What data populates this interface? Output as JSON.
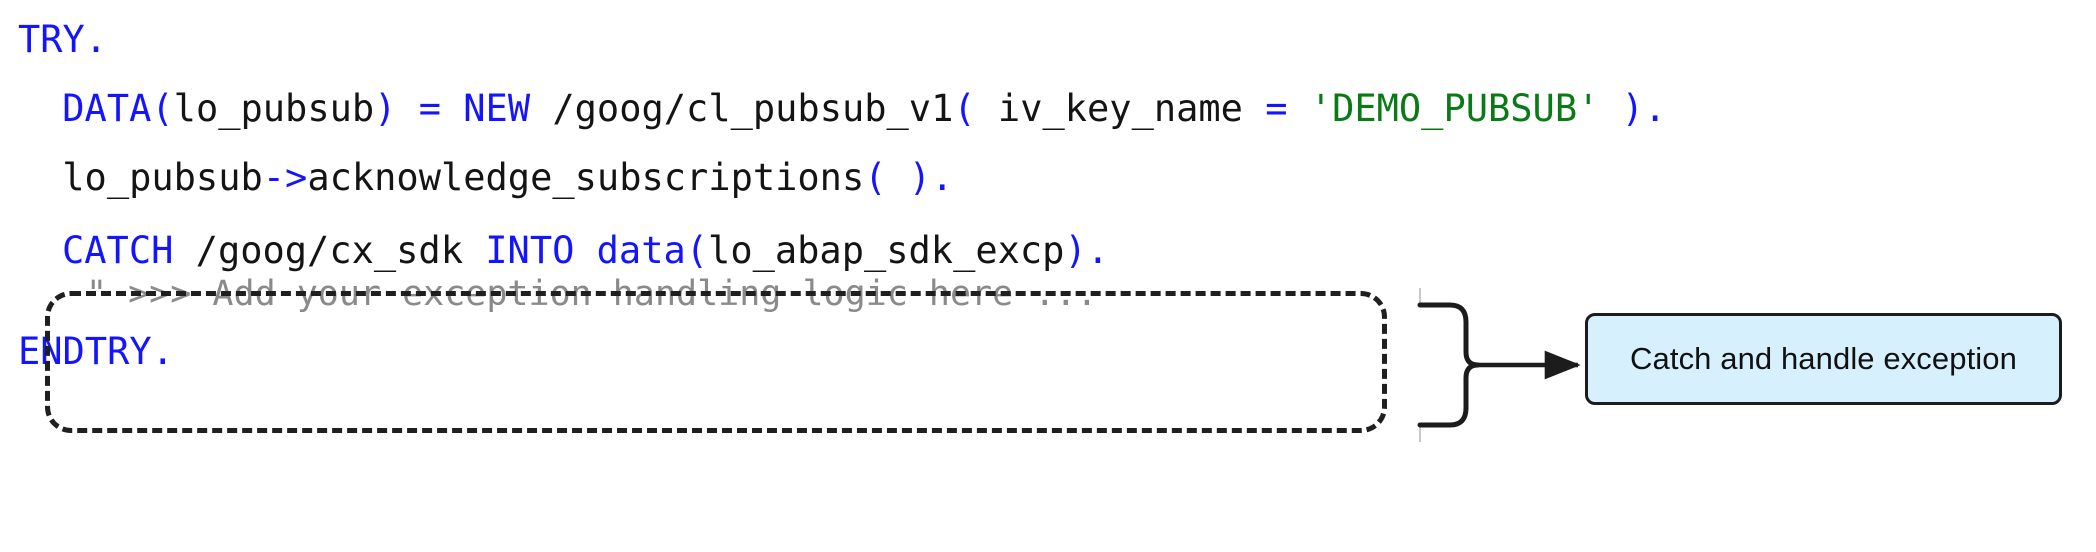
{
  "document": {
    "kind": "code-snippet-diagram",
    "language": "ABAP"
  },
  "colors": {
    "background": "#ffffff",
    "keyword": "#1414ff",
    "string": "#0a7a16",
    "identifier": "#141414",
    "comment": "#8a8a8a",
    "callout_fill": "#d7f0fd",
    "callout_border": "#1c1c1c",
    "dashed_border": "#1f1f1f",
    "connector": "#1c1c1c"
  },
  "code": {
    "lines": [
      {
        "id": "line-try",
        "tokens": [
          {
            "t": "TRY",
            "c": "kw"
          },
          {
            "t": ".",
            "c": "kw"
          }
        ]
      },
      {
        "id": "line-data",
        "tokens": [
          {
            "t": " DATA",
            "c": "kw"
          },
          {
            "t": "(",
            "c": "kw"
          },
          {
            "t": "lo_pubsub",
            "c": "id"
          },
          {
            "t": ")",
            "c": "kw"
          },
          {
            "t": " ",
            "c": "id"
          },
          {
            "t": "=",
            "c": "kw"
          },
          {
            "t": " ",
            "c": "id"
          },
          {
            "t": "NEW",
            "c": "kw"
          },
          {
            "t": " /goog/cl_pubsub_v1",
            "c": "id"
          },
          {
            "t": "(",
            "c": "kw"
          },
          {
            "t": " iv_key_name ",
            "c": "id"
          },
          {
            "t": "=",
            "c": "kw"
          },
          {
            "t": " ",
            "c": "id"
          },
          {
            "t": "'DEMO_PUBSUB'",
            "c": "str"
          },
          {
            "t": " ",
            "c": "id"
          },
          {
            "t": ")",
            "c": "kw"
          },
          {
            "t": ".",
            "c": "kw"
          }
        ]
      },
      {
        "id": "line-ack",
        "tokens": [
          {
            "t": " lo_pubsub",
            "c": "id"
          },
          {
            "t": "->",
            "c": "kw"
          },
          {
            "t": "acknowledge_subscriptions",
            "c": "id"
          },
          {
            "t": "(",
            "c": "kw"
          },
          {
            "t": " ",
            "c": "id"
          },
          {
            "t": ")",
            "c": "kw"
          },
          {
            "t": ".",
            "c": "kw"
          }
        ]
      },
      {
        "id": "line-catch",
        "tokens": [
          {
            "t": "CATCH",
            "c": "kw"
          },
          {
            "t": " /goog/cx_sdk ",
            "c": "id"
          },
          {
            "t": "INTO",
            "c": "kw"
          },
          {
            "t": " ",
            "c": "id"
          },
          {
            "t": "data",
            "c": "kw"
          },
          {
            "t": "(",
            "c": "kw"
          },
          {
            "t": "lo_abap_sdk_excp",
            "c": "id"
          },
          {
            "t": ")",
            "c": "kw"
          },
          {
            "t": ".",
            "c": "kw"
          }
        ]
      },
      {
        "id": "line-comment",
        "tokens": [
          {
            "t": "\" >>> Add your exception handling logic here ...",
            "c": "cmt"
          }
        ]
      },
      {
        "id": "line-endtry",
        "tokens": [
          {
            "t": "ENDTRY",
            "c": "kw"
          },
          {
            "t": ".",
            "c": "kw"
          }
        ]
      }
    ],
    "plain_text": [
      "TRY.",
      " DATA(lo_pubsub) = NEW /goog/cl_pubsub_v1( iv_key_name = 'DEMO_PUBSUB' ).",
      " lo_pubsub->acknowledge_subscriptions( ).",
      "CATCH /goog/cx_sdk INTO data(lo_abap_sdk_excp).",
      "  \" >>> Add your exception handling logic here ...",
      "ENDTRY."
    ]
  },
  "annotation": {
    "highlight": {
      "style": "dashed-rounded-rectangle",
      "covers_lines": [
        "line-catch",
        "line-comment"
      ]
    },
    "connector": {
      "style": "curly-brace-then-arrow",
      "direction": "left-to-right"
    },
    "callout": {
      "label": "Catch and handle exception"
    }
  }
}
